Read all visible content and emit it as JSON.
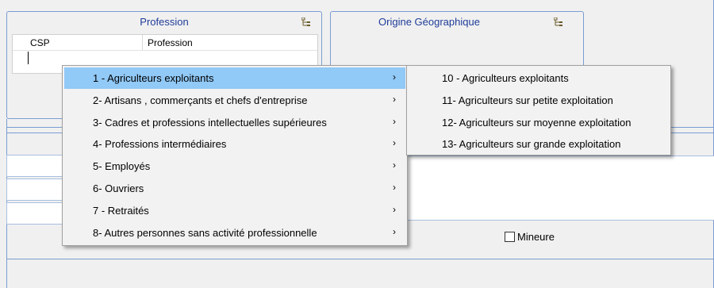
{
  "profession_panel": {
    "title": "Profession",
    "col_csp": "CSP",
    "col_profession": "Profession"
  },
  "origin_panel": {
    "title": "Origine Géographique"
  },
  "checkbox_mineure": {
    "label": "Mineure",
    "checked": false
  },
  "context_menu": {
    "items": [
      {
        "label": "1 - Agriculteurs exploitants",
        "selected": true
      },
      {
        "label": "2- Artisans , commerçants et chefs d'entreprise"
      },
      {
        "label": "3- Cadres et professions intellectuelles supérieures"
      },
      {
        "label": "4- Professions intermédiaires"
      },
      {
        "label": "5- Employés"
      },
      {
        "label": "6- Ouvriers"
      },
      {
        "label": "7 - Retraités"
      },
      {
        "label": "8- Autres personnes sans activité professionnelle"
      }
    ],
    "chevron": "›"
  },
  "submenu": {
    "items": [
      {
        "label": "10 - Agriculteurs exploitants"
      },
      {
        "label": "11- Agriculteurs sur petite exploitation"
      },
      {
        "label": "12- Agriculteurs sur moyenne exploitation"
      },
      {
        "label": "13- Agriculteurs sur grande exploitation"
      }
    ]
  },
  "colors": {
    "accent_border": "#7a9cd3",
    "title_text": "#1f3c99",
    "selection": "#91c9f7"
  }
}
